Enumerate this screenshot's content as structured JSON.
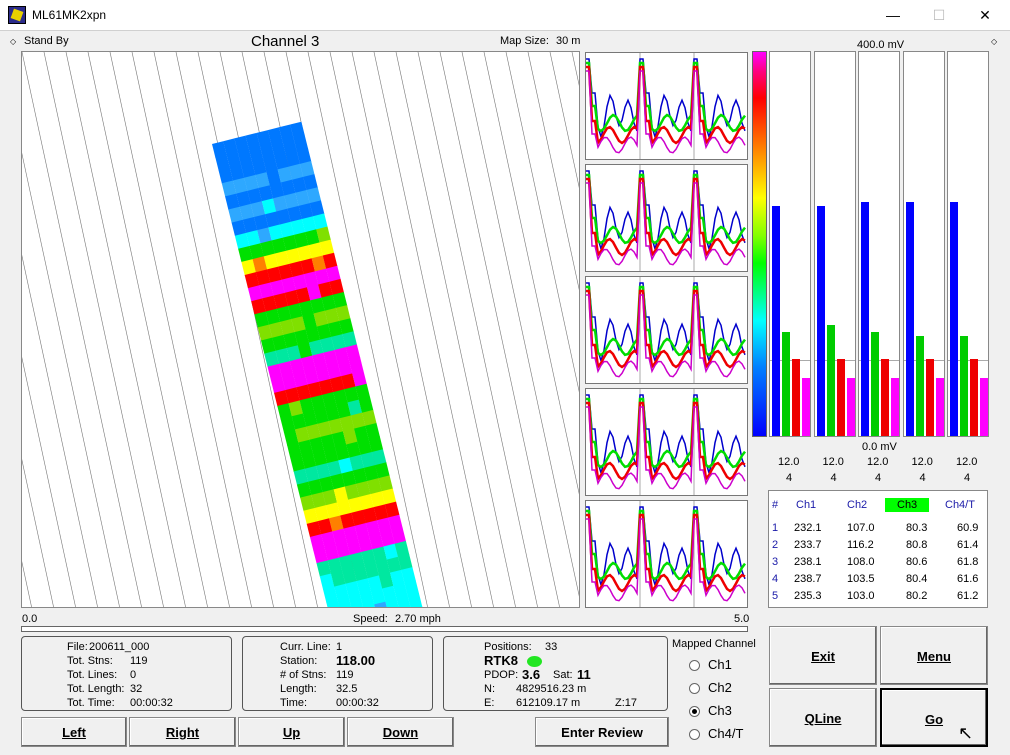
{
  "window": {
    "title": "ML61MK2xpn",
    "min": "—",
    "max": "☐",
    "close": "✕"
  },
  "status": {
    "mode": "Stand By",
    "channel_title": "Channel 3",
    "map_size_label": "Map Size:",
    "map_size_value": "30 m"
  },
  "scale": {
    "left": "0.0",
    "right": "5.0",
    "speed_label": "Speed:",
    "speed_value": "2.70 mph"
  },
  "bars": {
    "top_label": "400.0 mV",
    "bottom_label": "0.0 mV",
    "columns": [
      {
        "range": "12.0",
        "n": "4",
        "values": [
          0.6,
          0.27,
          0.2,
          0.15
        ]
      },
      {
        "range": "12.0",
        "n": "4",
        "values": [
          0.6,
          0.29,
          0.2,
          0.15
        ]
      },
      {
        "range": "12.0",
        "n": "4",
        "values": [
          0.61,
          0.27,
          0.2,
          0.15
        ]
      },
      {
        "range": "12.0",
        "n": "4",
        "values": [
          0.61,
          0.26,
          0.2,
          0.15
        ]
      },
      {
        "range": "12.0",
        "n": "4",
        "values": [
          0.61,
          0.26,
          0.2,
          0.15
        ]
      }
    ],
    "colors": [
      "#0000ff",
      "#00cc00",
      "#ee0000",
      "#ff00ff"
    ]
  },
  "table": {
    "headers": [
      "#",
      "Ch1",
      "Ch2",
      "Ch3",
      "Ch4/T"
    ],
    "highlight_color": "#00ff00",
    "rows": [
      [
        "1",
        "232.1",
        "107.0",
        "80.3",
        "60.9"
      ],
      [
        "2",
        "233.7",
        "116.2",
        "80.8",
        "61.4"
      ],
      [
        "3",
        "238.1",
        "108.0",
        "80.6",
        "61.8"
      ],
      [
        "4",
        "238.7",
        "103.5",
        "80.4",
        "61.6"
      ],
      [
        "5",
        "235.3",
        "103.0",
        "80.2",
        "61.2"
      ]
    ]
  },
  "file_panel": {
    "file_label": "File:",
    "file_value": "200611_000",
    "stns_label": "Tot. Stns:",
    "stns_value": "119",
    "lines_label": "Tot. Lines:",
    "lines_value": "0",
    "length_label": "Tot. Length:",
    "length_value": "32",
    "time_label": "Tot. Time:",
    "time_value": "00:00:32"
  },
  "line_panel": {
    "line_label": "Curr. Line:",
    "line_value": "1",
    "station_label": "Station:",
    "station_value": "118.00",
    "nstns_label": "# of Stns:",
    "nstns_value": "119",
    "length_label": "Length:",
    "length_value": "32.5",
    "time_label": "Time:",
    "time_value": "00:00:32"
  },
  "gps_panel": {
    "positions_label": "Positions:",
    "positions_value": "33",
    "rtk": "RTK8",
    "pdop_label": "PDOP:",
    "pdop_value": "3.6",
    "sat_label": "Sat:",
    "sat_value": "11",
    "n_label": "N:",
    "n_value": "4829516.23 m",
    "e_label": "E:",
    "e_value": "612109.17 m",
    "z_label": "Z:17"
  },
  "mapped": {
    "title": "Mapped Channel",
    "options": [
      "Ch1",
      "Ch2",
      "Ch3",
      "Ch4/T"
    ],
    "selected": 2
  },
  "buttons": {
    "left": "Left",
    "right": "Right",
    "up": "Up",
    "down": "Down",
    "review": "Enter Review",
    "exit": "Exit",
    "menu": "Menu",
    "qline": "QLine",
    "go": "Go"
  },
  "strip_color_key": [
    "#0078ff",
    "#2ea8ff",
    "#00ffff",
    "#00e8a0",
    "#00e000",
    "#80e000",
    "#ffff00",
    "#ff8000",
    "#ff0000",
    "#ff00ff"
  ]
}
